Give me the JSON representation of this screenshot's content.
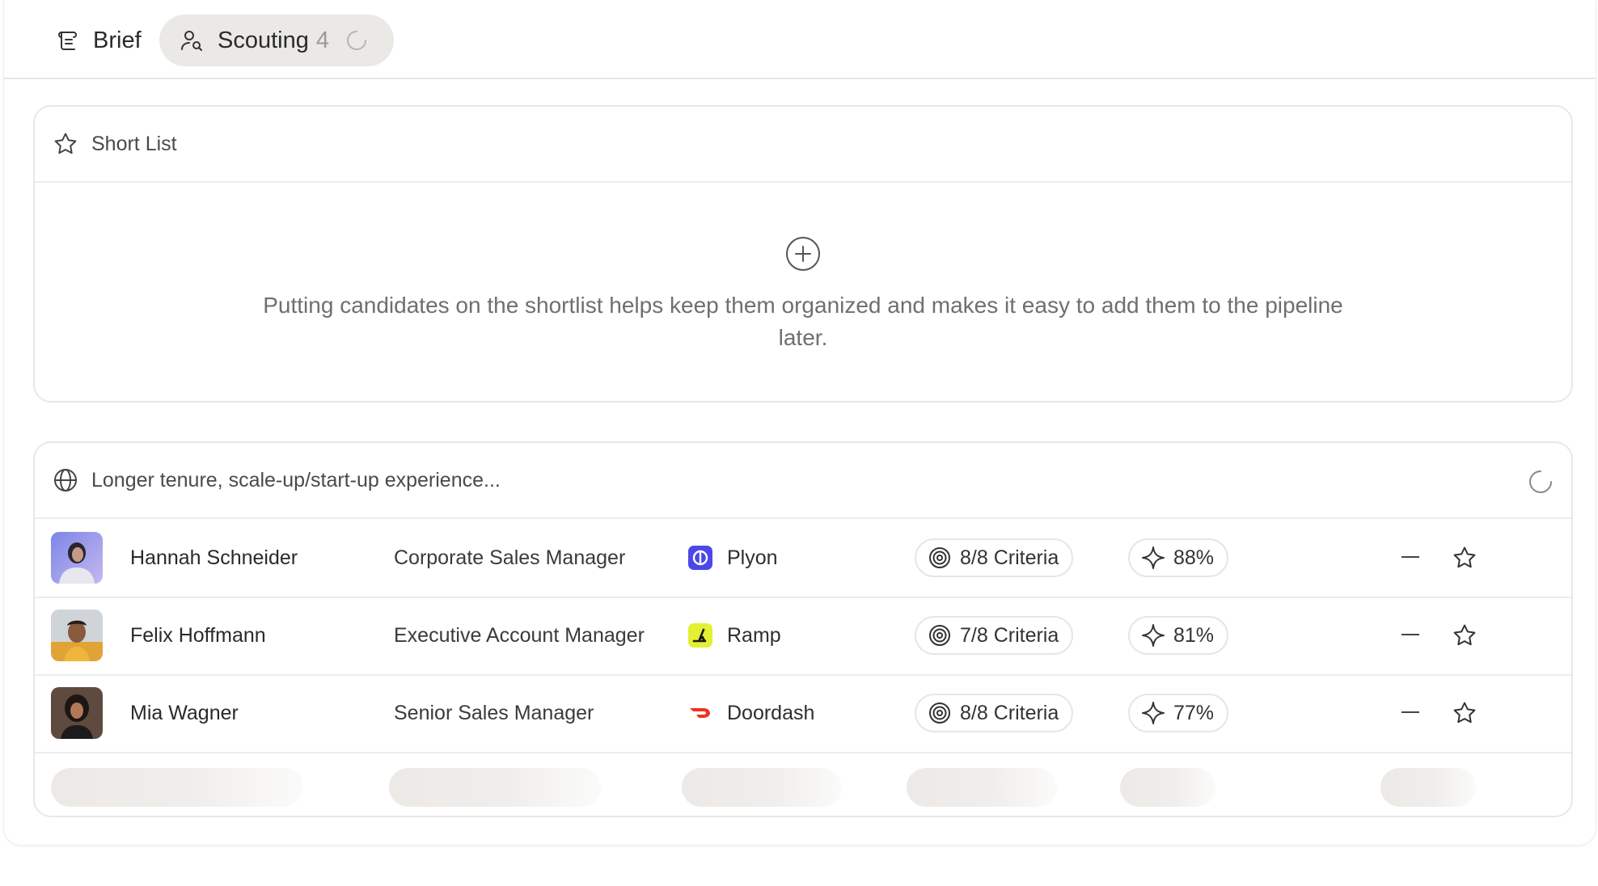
{
  "tabs": [
    {
      "label": "Brief",
      "icon": "brief-icon"
    },
    {
      "label": "Scouting",
      "count": "4",
      "icon": "user-search-icon",
      "active": true
    }
  ],
  "shortlist": {
    "title": "Short List",
    "empty_message": "Putting candidates on the shortlist helps keep them organized and makes it easy to add them to the pipeline later."
  },
  "search": {
    "query": "Longer tenure, scale-up/start-up experience...",
    "candidates": [
      {
        "name": "Hannah Schneider",
        "role": "Corporate Sales Manager",
        "company": "Plyon",
        "company_color": "#4a48e8",
        "criteria": "8/8 Criteria",
        "score": "88%"
      },
      {
        "name": "Felix Hoffmann",
        "role": "Executive Account Manager",
        "company": "Ramp",
        "company_color": "#e4f032",
        "criteria": "7/8 Criteria",
        "score": "81%"
      },
      {
        "name": "Mia Wagner",
        "role": "Senior Sales Manager",
        "company": "Doordash",
        "company_color": "#ee3322",
        "criteria": "8/8 Criteria",
        "score": "77%"
      }
    ]
  },
  "colors": {
    "accent_bg": "#ebe9e6",
    "border": "#e8e8e8",
    "muted_text": "#6f6f6f"
  }
}
